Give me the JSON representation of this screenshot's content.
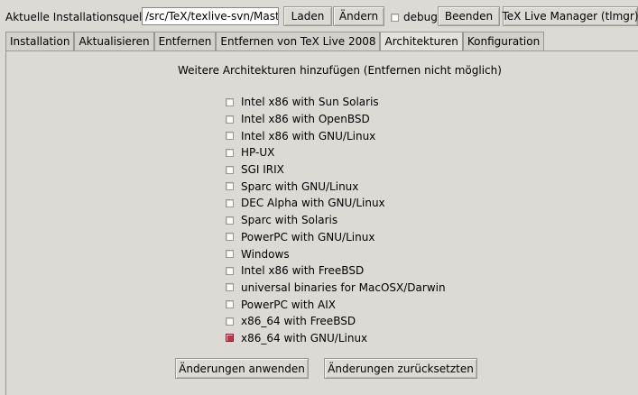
{
  "toolbar": {
    "source_label": "Aktuelle Installationsquelle",
    "source_value": "/src/TeX/texlive-svn/Master",
    "load_label": "Laden",
    "change_label": "Ändern",
    "debug_label": "debug",
    "debug_checked": false,
    "quit_label": "Beenden",
    "app_label": "TeX Live Manager (tlmgr)"
  },
  "tabs": [
    {
      "label": "Installation",
      "active": false
    },
    {
      "label": "Aktualisieren",
      "active": false
    },
    {
      "label": "Entfernen",
      "active": false
    },
    {
      "label": "Entfernen von TeX Live 2008",
      "active": false
    },
    {
      "label": "Architekturen",
      "active": true
    },
    {
      "label": "Konfiguration",
      "active": false
    }
  ],
  "main": {
    "heading": "Weitere Architekturen hinzufügen (Entfernen nicht möglich)",
    "architectures": [
      {
        "label": "Intel x86 with Sun Solaris",
        "checked": false
      },
      {
        "label": "Intel x86 with OpenBSD",
        "checked": false
      },
      {
        "label": "Intel x86 with GNU/Linux",
        "checked": false
      },
      {
        "label": "HP-UX",
        "checked": false
      },
      {
        "label": "SGI IRIX",
        "checked": false
      },
      {
        "label": "Sparc with GNU/Linux",
        "checked": false
      },
      {
        "label": "DEC Alpha with GNU/Linux",
        "checked": false
      },
      {
        "label": "Sparc with Solaris",
        "checked": false
      },
      {
        "label": "PowerPC with GNU/Linux",
        "checked": false
      },
      {
        "label": "Windows",
        "checked": false
      },
      {
        "label": "Intel x86 with FreeBSD",
        "checked": false
      },
      {
        "label": "universal binaries for MacOSX/Darwin",
        "checked": false
      },
      {
        "label": "PowerPC with AIX",
        "checked": false
      },
      {
        "label": "x86_64 with FreeBSD",
        "checked": false
      },
      {
        "label": "x86_64 with GNU/Linux",
        "checked": true
      }
    ],
    "apply_label": "Änderungen anwenden",
    "reset_label": "Änderungen zurücksetzten"
  },
  "colors": {
    "background": "#dcdad5",
    "checked_box": "#b5384a"
  }
}
